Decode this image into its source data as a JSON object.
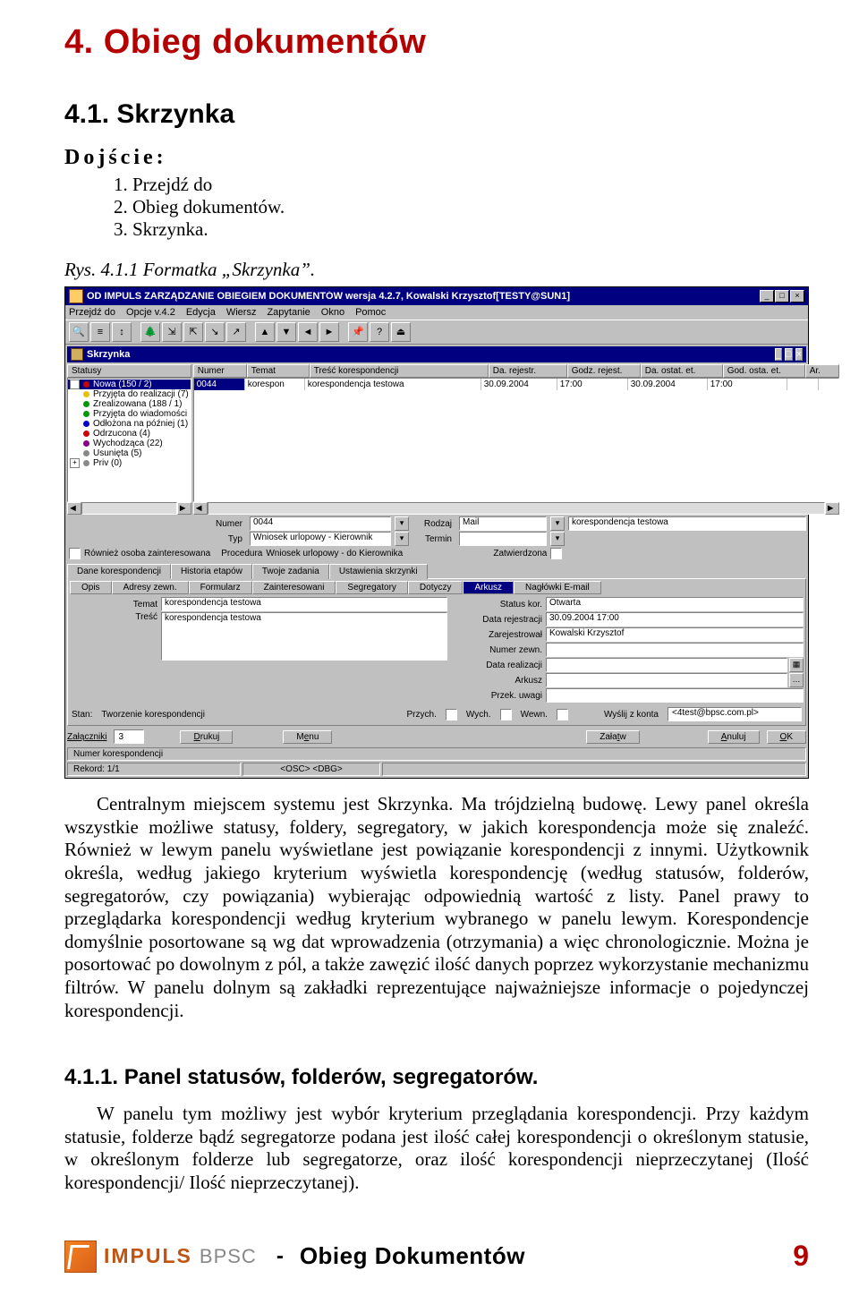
{
  "headings": {
    "h1": "4.   Obieg dokumentów",
    "h2": "4.1.    Skrzynka",
    "h3": "4.1.1.     Panel statusów, folderów, segregatorów."
  },
  "access": {
    "label": "Dojście:",
    "steps": [
      "Przejdź do",
      "Obieg dokumentów.",
      "Skrzynka."
    ]
  },
  "figure_caption": "Rys. 4.1.1 Formatka „Skrzynka”.",
  "paragraphs": {
    "p1": "Centralnym miejscem systemu jest Skrzynka. Ma trójdzielną budowę. Lewy panel określa wszystkie możliwe statusy, foldery, segregatory, w jakich korespondencja może się znaleźć. Również w lewym panelu wyświetlane jest powiązanie korespondencji z innymi. Użytkownik określa, według jakiego kryterium wyświetla korespondencję (według statusów, folderów, segregatorów, czy powiązania) wybierając odpowiednią wartość z listy. Panel prawy to przeglądarka korespondencji według kryterium wybranego w panelu lewym. Korespondencje domyślnie posortowane są wg dat wprowadzenia (otrzymania) a więc chronologicznie. Można je posortować po dowolnym z pól, a także zawęzić ilość danych poprzez wykorzystanie mechanizmu filtrów. W panelu dolnym są zakładki reprezentujące najważniejsze informacje o pojedynczej korespondencji.",
    "p2": "W panelu tym możliwy jest wybór kryterium przeglądania korespondencji. Przy każdym statusie, folderze bądź segregatorze podana jest ilość całej korespondencji o określonym statusie, w określonym folderze lub segregatorze, oraz ilość korespondencji nieprzeczytanej (Ilość korespondencji/ Ilość nieprzeczytanej)."
  },
  "footer": {
    "brand1": "IMPULS",
    "brand2": "BPSC",
    "dash": "-",
    "section": "Obieg Dokumentów",
    "page": "9"
  },
  "scr": {
    "title": "OD IMPULS ZARZĄDZANIE OBIEGIEM DOKUMENTÓW wersja 4.2.7, Kowalski Krzysztof[TESTY@SUN1]",
    "menus": [
      "Przejdź do",
      "Opcje v.4.2",
      "Edycja",
      "Wiersz",
      "Zapytanie",
      "Okno",
      "Pomoc"
    ],
    "toolbar_icons": [
      "search-icon",
      "filter-icon",
      "sort-icon",
      "tree-icon",
      "in-icon",
      "out-icon",
      "in2-icon",
      "out2-icon",
      "up-icon",
      "down-icon",
      "left-icon",
      "right-icon",
      "pin-icon",
      "help-icon",
      "exit-icon"
    ],
    "inner_title": "Skrzynka",
    "tree_header": "Statusy",
    "tree": [
      {
        "exp": "-",
        "color": "red",
        "label": "Nowa  (150 / 2)",
        "sel": true
      },
      {
        "exp": "",
        "color": "yellow",
        "label": "Przyjęta do realizacji  (7)"
      },
      {
        "exp": "",
        "color": "green",
        "label": "Zrealizowana  (188 / 1)"
      },
      {
        "exp": "",
        "color": "green",
        "label": "Przyjęta do wiadomości"
      },
      {
        "exp": "",
        "color": "blue",
        "label": "Odłożona na później  (1)"
      },
      {
        "exp": "",
        "color": "red",
        "label": "Odrzucona  (4)"
      },
      {
        "exp": "",
        "color": "purple",
        "label": "Wychodząca  (22)"
      },
      {
        "exp": "",
        "color": "gray",
        "label": "Usunięta  (5)"
      },
      {
        "exp": "+",
        "color": "gray",
        "label": "Priv  (0)"
      }
    ],
    "grid_headers": [
      "Numer",
      "Temat",
      "Treść korespondencji",
      "Da. rejestr.",
      "Godz. rejest.",
      "Da. ostat. et.",
      "God. osta. et.",
      "Ar."
    ],
    "grid_widths": [
      50,
      60,
      190,
      78,
      72,
      82,
      82,
      28
    ],
    "grid_row": [
      "0044",
      "korespon",
      "korespondencja testowa",
      "30.09.2004",
      "17:00",
      "30.09.2004",
      "17:00",
      ""
    ],
    "details": {
      "numer_l": "Numer",
      "numer": "0044",
      "rodzaj_l": "Rodzaj",
      "rodzaj": "Mail",
      "temat_top": "korespondencja testowa",
      "typ_l": "Typ",
      "typ": "Wniosek urlopowy - Kierownik",
      "termin_l": "Termin",
      "termin": "",
      "procedura_l": "Procedura",
      "procedura": "Wniosek urlopowy - do Kierownika",
      "zatw_l": "Zatwierdzona",
      "zatw_box": ""
    },
    "chk_interested": "Również osoba zainteresowana",
    "tabs1": [
      "Dane korespondencji",
      "Historia etapów",
      "Twoje zadania",
      "Ustawienia skrzynki"
    ],
    "subtabs": [
      "Opis",
      "Adresy zewn.",
      "Formularz",
      "Zainteresowani",
      "Segregatory",
      "Dotyczy",
      "Arkusz",
      "Nagłówki E-mail"
    ],
    "subtabs_hot": 6,
    "form": {
      "temat_l": "Temat",
      "temat": "korespondencja testowa",
      "tresc_l": "Treść",
      "tresc": "korespondencja testowa",
      "status_l": "Status kor.",
      "status": "Otwarta",
      "datarej_l": "Data rejestracji",
      "datarej": "30.09.2004 17:00",
      "zarej_l": "Zarejestrował",
      "zarej": "Kowalski Krzysztof",
      "nzewn_l": "Numer zewn.",
      "nzewn": "",
      "datareal_l": "Data realizacji",
      "datareal": "",
      "arkusz_l": "Arkusz",
      "arkusz": "",
      "uwagi_l": "Przek. uwagi",
      "uwagi": ""
    },
    "state": {
      "stan_l": "Stan:",
      "stan": "Tworzenie korespondencji",
      "przych": "Przych.",
      "wych": "Wych.",
      "wewn": "Wewn.",
      "wyslij_l": "Wyślij z konta",
      "wyslij": "<4test@bpsc.com.pl>"
    },
    "actions": {
      "zal_l": "Załączniki",
      "zal_cnt": "3",
      "drukuj": "Drukuj",
      "menu": "Menu",
      "zalatw": "Załatw",
      "anuluj": "Anuluj",
      "ok": "OK"
    },
    "status": {
      "s1": "Numer korespondencji",
      "s2": "Rekord: 1/1",
      "s3": "<OSC> <DBG>"
    }
  }
}
